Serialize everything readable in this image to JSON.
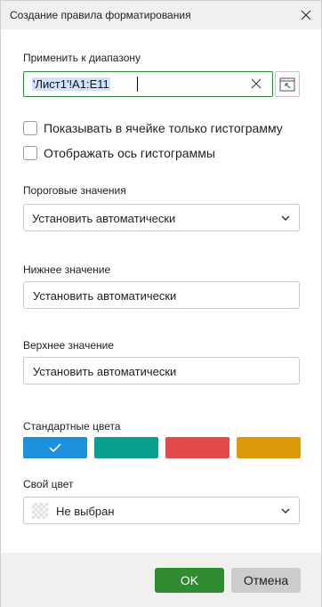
{
  "dialog": {
    "title": "Создание правила форматирования",
    "close_icon": "close-icon"
  },
  "range": {
    "label": "Применить к диапазону",
    "value": "'Лист1'!A1:E11",
    "clear_icon": "clear-x-icon",
    "select_icon": "select-range-icon"
  },
  "options": {
    "show_bar_only": "Показывать в ячейке только гистограмму",
    "show_axis": "Отображать ось гистограммы"
  },
  "thresholds": {
    "label": "Пороговые значения",
    "value": "Установить автоматически"
  },
  "min_value": {
    "label": "Нижнее значение",
    "value": "Установить автоматически"
  },
  "max_value": {
    "label": "Верхнее значение",
    "value": "Установить автоматически"
  },
  "standard_colors": {
    "label": "Стандартные цвета",
    "colors": [
      "#1e8fdc",
      "#0aa08e",
      "#e34b4b",
      "#dc9a0a"
    ],
    "selected_index": 0
  },
  "custom_color": {
    "label": "Свой цвет",
    "value": "Не выбран"
  },
  "footer": {
    "ok_label": "OK",
    "cancel_label": "Отмена",
    "ok_color": "#2f8b2f"
  }
}
